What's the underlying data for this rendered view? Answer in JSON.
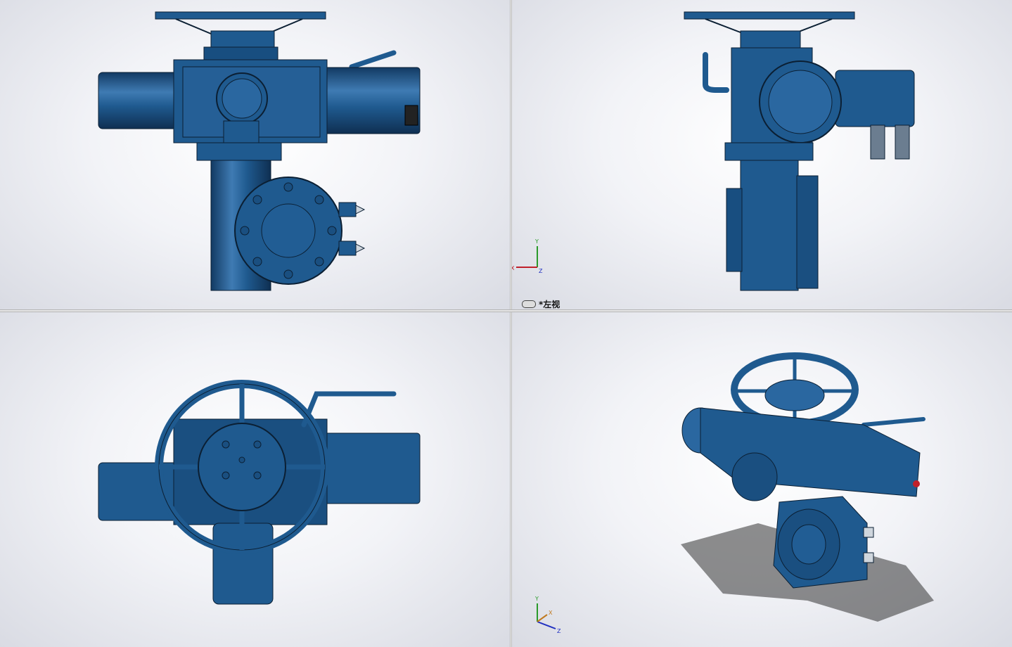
{
  "viewports": {
    "top_left": {
      "name": "front-view"
    },
    "top_right": {
      "name": "left-view",
      "label": "*左视",
      "triad": {
        "x": "X",
        "y": "Y",
        "z": "Z"
      }
    },
    "bottom_left": {
      "name": "top-view"
    },
    "bottom_right": {
      "name": "isometric-view",
      "triad": {
        "x": "X",
        "y": "Y",
        "z": "Z"
      }
    }
  },
  "colors": {
    "body": "#1f5a8f",
    "body_dark": "#123a63",
    "body_light": "#3f7bb3",
    "edge": "#0b1f33",
    "background_center": "#ffffff",
    "background_edge": "#d9dbe3"
  }
}
